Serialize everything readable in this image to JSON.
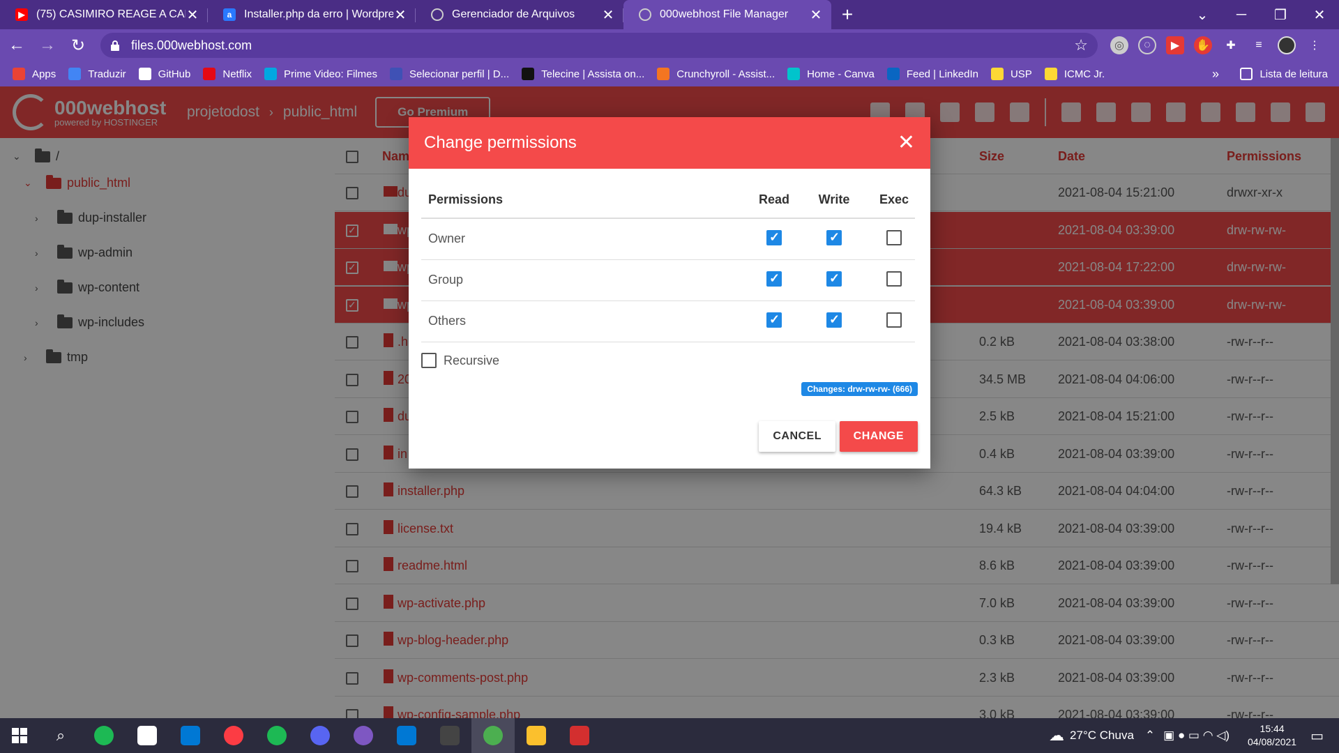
{
  "browser": {
    "tabs": [
      {
        "title": "(75) CASIMIRO REAGE A CARIOCA",
        "favicon": "youtube-icon",
        "color": "#ff0000",
        "glyph": "▶"
      },
      {
        "title": "Installer.php da erro | Wordpress",
        "favicon": "letter-a-icon",
        "color": "#2979ff",
        "glyph": "a"
      },
      {
        "title": "Gerenciador de Arquivos",
        "favicon": "globe-icon",
        "color": "#9e9e9e",
        "glyph": ""
      },
      {
        "title": "000webhost File Manager",
        "favicon": "globe-icon",
        "color": "#9e9e9e",
        "glyph": ""
      }
    ],
    "url": "files.000webhost.com",
    "bookmarks": [
      {
        "label": "Apps",
        "color": "#ea4335"
      },
      {
        "label": "Traduzir",
        "color": "#4285f4"
      },
      {
        "label": "GitHub",
        "color": "#ffffff"
      },
      {
        "label": "Netflix",
        "color": "#e50914"
      },
      {
        "label": "Prime Video: Filmes",
        "color": "#00a8e1"
      },
      {
        "label": "Selecionar perfil | D...",
        "color": "#3f51b5"
      },
      {
        "label": "Telecine | Assista on...",
        "color": "#111111"
      },
      {
        "label": "Crunchyroll - Assist...",
        "color": "#f47521"
      },
      {
        "label": "Home - Canva",
        "color": "#00c4cc"
      },
      {
        "label": "Feed | LinkedIn",
        "color": "#0a66c2"
      },
      {
        "label": "USP",
        "color": "#fdd835"
      },
      {
        "label": "ICMC Jr.",
        "color": "#fdd835"
      }
    ],
    "reading_list": "Lista de leitura"
  },
  "app": {
    "logo_main": "000webhost",
    "logo_sub": "powered by HOSTINGER",
    "breadcrumb": [
      "projetodost",
      "public_html"
    ],
    "go_premium": "Go Premium"
  },
  "tree": {
    "root": "/",
    "items": [
      {
        "label": "public_html",
        "level": 1,
        "expanded": true,
        "active": true
      },
      {
        "label": "dup-installer",
        "level": 2
      },
      {
        "label": "wp-admin",
        "level": 2
      },
      {
        "label": "wp-content",
        "level": 2
      },
      {
        "label": "wp-includes",
        "level": 2
      },
      {
        "label": "tmp",
        "level": 1
      }
    ]
  },
  "files": {
    "headers": {
      "name": "Nam",
      "size": "Size",
      "date": "Date",
      "permissions": "Permissions"
    },
    "rows": [
      {
        "name": "du",
        "size": "",
        "date": "2021-08-04 15:21:00",
        "perm": "drwxr-xr-x",
        "folder": true,
        "selected": false
      },
      {
        "name": "wp",
        "size": "",
        "date": "2021-08-04 03:39:00",
        "perm": "drw-rw-rw-",
        "folder": true,
        "selected": true
      },
      {
        "name": "wp",
        "size": "",
        "date": "2021-08-04 17:22:00",
        "perm": "drw-rw-rw-",
        "folder": true,
        "selected": true
      },
      {
        "name": "wp",
        "size": "",
        "date": "2021-08-04 03:39:00",
        "perm": "drw-rw-rw-",
        "folder": true,
        "selected": true
      },
      {
        "name": ".h",
        "size": "0.2 kB",
        "date": "2021-08-04 03:38:00",
        "perm": "-rw-r--r--",
        "folder": false,
        "selected": false
      },
      {
        "name": "20",
        "size": "34.5 MB",
        "date": "2021-08-04 04:06:00",
        "perm": "-rw-r--r--",
        "folder": false,
        "selected": false
      },
      {
        "name": "du",
        "size": "2.5 kB",
        "date": "2021-08-04 15:21:00",
        "perm": "-rw-r--r--",
        "folder": false,
        "selected": false
      },
      {
        "name": "in",
        "size": "0.4 kB",
        "date": "2021-08-04 03:39:00",
        "perm": "-rw-r--r--",
        "folder": false,
        "selected": false
      },
      {
        "name": "installer.php",
        "size": "64.3 kB",
        "date": "2021-08-04 04:04:00",
        "perm": "-rw-r--r--",
        "folder": false,
        "selected": false
      },
      {
        "name": "license.txt",
        "size": "19.4 kB",
        "date": "2021-08-04 03:39:00",
        "perm": "-rw-r--r--",
        "folder": false,
        "selected": false
      },
      {
        "name": "readme.html",
        "size": "8.6 kB",
        "date": "2021-08-04 03:39:00",
        "perm": "-rw-r--r--",
        "folder": false,
        "selected": false
      },
      {
        "name": "wp-activate.php",
        "size": "7.0 kB",
        "date": "2021-08-04 03:39:00",
        "perm": "-rw-r--r--",
        "folder": false,
        "selected": false
      },
      {
        "name": "wp-blog-header.php",
        "size": "0.3 kB",
        "date": "2021-08-04 03:39:00",
        "perm": "-rw-r--r--",
        "folder": false,
        "selected": false
      },
      {
        "name": "wp-comments-post.php",
        "size": "2.3 kB",
        "date": "2021-08-04 03:39:00",
        "perm": "-rw-r--r--",
        "folder": false,
        "selected": false
      },
      {
        "name": "wp-config-sample.php",
        "size": "3.0 kB",
        "date": "2021-08-04 03:39:00",
        "perm": "-rw-r--r--",
        "folder": false,
        "selected": false
      }
    ]
  },
  "modal": {
    "title": "Change permissions",
    "headers": {
      "label": "Permissions",
      "read": "Read",
      "write": "Write",
      "exec": "Exec"
    },
    "rows": [
      {
        "label": "Owner",
        "read": true,
        "write": true,
        "exec": false
      },
      {
        "label": "Group",
        "read": true,
        "write": true,
        "exec": false
      },
      {
        "label": "Others",
        "read": true,
        "write": true,
        "exec": false
      }
    ],
    "recursive_label": "Recursive",
    "recursive": false,
    "changes": "Changes: drw-rw-rw- (666)",
    "cancel": "CANCEL",
    "change": "CHANGE"
  },
  "taskbar": {
    "weather": "27°C  Chuva",
    "time": "15:44",
    "date": "04/08/2021",
    "apps": [
      {
        "name": "app-icon",
        "color": "#1db954"
      },
      {
        "name": "store-icon",
        "color": "#ffffff"
      },
      {
        "name": "mail-icon",
        "color": "#0078d4"
      },
      {
        "name": "itunes-icon",
        "color": "#fc3c44"
      },
      {
        "name": "spotify-icon",
        "color": "#1db954"
      },
      {
        "name": "discord-icon",
        "color": "#5865f2"
      },
      {
        "name": "app-icon",
        "color": "#7e57c2"
      },
      {
        "name": "vscode-icon",
        "color": "#0078d4"
      },
      {
        "name": "terminal-icon",
        "color": "#444444"
      },
      {
        "name": "chrome-icon",
        "color": "#4caf50"
      },
      {
        "name": "explorer-icon",
        "color": "#fbc02d"
      },
      {
        "name": "filezilla-icon",
        "color": "#d32f2f"
      }
    ]
  }
}
